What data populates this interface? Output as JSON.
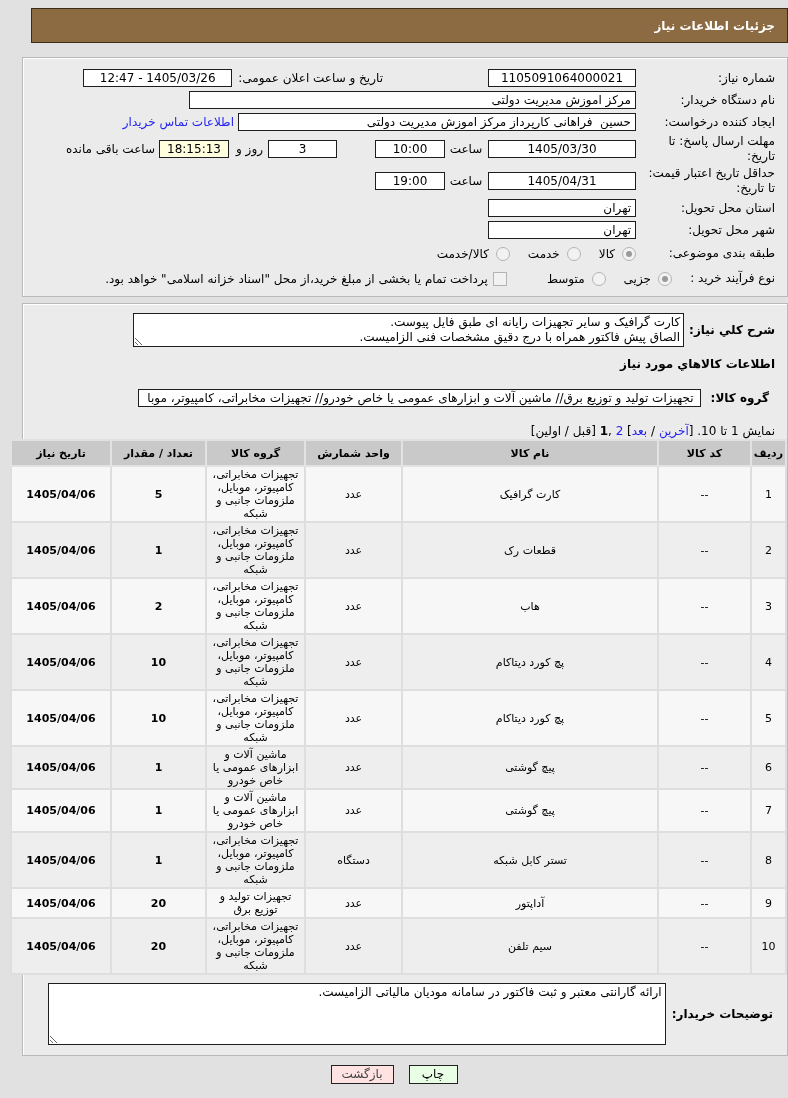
{
  "header": {
    "title": "جزئیات اطلاعات نیاز"
  },
  "details": {
    "need_number": {
      "label": "شماره نیاز:",
      "value": "1105091064000021"
    },
    "announce_datetime": {
      "label": "تاریخ و ساعت اعلان عمومی:",
      "value": "1405/03/26 - 12:47"
    },
    "buyer_org": {
      "label": "نام دستگاه خریدار:",
      "value": "مرکز اموزش مدیریت دولتی"
    },
    "requester": {
      "label": "ایجاد کننده درخواست:",
      "value": "حسین  فراهانی کارپرداز مرکز اموزش مدیریت دولتی",
      "contact_link": "اطلاعات تماس خریدار"
    },
    "reply_deadline": {
      "label": "مهلت ارسال پاسخ: تا تاریخ:",
      "date": "1405/03/30",
      "time_label": "ساعت",
      "time": "10:00",
      "days": "3",
      "days_label": "روز و",
      "remaining": "18:15:13",
      "remaining_label": "ساعت باقی مانده"
    },
    "price_validity": {
      "label": "حداقل تاریخ اعتبار قیمت: تا تاریخ:",
      "date": "1405/04/31",
      "time_label": "ساعت",
      "time": "19:00"
    },
    "province": {
      "label": "استان محل تحویل:",
      "value": "تهران"
    },
    "city": {
      "label": "شهر محل تحویل:",
      "value": "تهران"
    },
    "category": {
      "label": "طبقه بندی موضوعی:",
      "options": [
        {
          "label": "کالا",
          "selected": true
        },
        {
          "label": "خدمت",
          "selected": false
        },
        {
          "label": "کالا/خدمت",
          "selected": false
        }
      ]
    },
    "purchase_process": {
      "label": "نوع فرآیند خرید :",
      "options": [
        {
          "label": "جزیی",
          "selected": true
        },
        {
          "label": "متوسط",
          "selected": false
        }
      ],
      "treasury_payment": {
        "label": "پرداخت تمام یا بخشی از مبلغ خرید،از محل \"اسناد خزانه اسلامی\" خواهد بود.",
        "checked": false
      }
    }
  },
  "description": {
    "label": "شرح کلي نیاز:",
    "value": "کارت گرافیک و سایر تجهیزات رایانه ای طبق فایل پیوست.\nالصاق پیش فاکتور همراه با درج دقیق مشخصات فنی الزامیست."
  },
  "goods": {
    "title": "اطلاعات کالاهاي مورد نیاز",
    "group_label": "گروه کالا:",
    "group_value": "تجهیزات تولید و توزیع برق//  ماشین آلات و ابزارهای عمومی یا خاص خودرو// تجهیزات مخابراتی، کامپیوتر، موبا",
    "pagination": [
      {
        "kind": "text",
        "text": "نمایش 1 تا 10. ["
      },
      {
        "kind": "link",
        "text": "آخرین"
      },
      {
        "kind": "text",
        "text": " / "
      },
      {
        "kind": "link",
        "text": "بعد"
      },
      {
        "kind": "text",
        "text": "] "
      },
      {
        "kind": "link",
        "text": "2"
      },
      {
        "kind": "text",
        "text": " ,"
      },
      {
        "kind": "current",
        "text": "1"
      },
      {
        "kind": "text",
        "text": " [قبل / اولین]"
      }
    ],
    "table": {
      "columns": [
        "ردیف",
        "کد کالا",
        "نام کالا",
        "واحد شمارش",
        "گروه کالا",
        "تعداد / مقدار",
        "تاریخ نیاز"
      ],
      "rows": [
        [
          "1",
          "--",
          "کارت گرافیک",
          "عدد",
          "تجهیزات مخابراتی، کامپیوتر، موبایل، ملزومات جانبی و شبکه",
          "5",
          "1405/04/06"
        ],
        [
          "2",
          "--",
          "قطعات رک",
          "عدد",
          "تجهیزات مخابراتی، کامپیوتر، موبایل، ملزومات جانبی و شبکه",
          "1",
          "1405/04/06"
        ],
        [
          "3",
          "--",
          "هاب",
          "عدد",
          "تجهیزات مخابراتی، کامپیوتر، موبایل، ملزومات جانبی و شبکه",
          "2",
          "1405/04/06"
        ],
        [
          "4",
          "--",
          "پچ کورد دیتاکام",
          "عدد",
          "تجهیزات مخابراتی، کامپیوتر، موبایل، ملزومات جانبی و شبکه",
          "10",
          "1405/04/06"
        ],
        [
          "5",
          "--",
          "پچ کورد دیتاکام",
          "عدد",
          "تجهیزات مخابراتی، کامپیوتر، موبایل، ملزومات جانبی و شبکه",
          "10",
          "1405/04/06"
        ],
        [
          "6",
          "--",
          "پیچ گوشتی",
          "عدد",
          "ماشین آلات و ابزارهای عمومی یا خاص خودرو",
          "1",
          "1405/04/06"
        ],
        [
          "7",
          "--",
          "پیچ گوشتی",
          "عدد",
          "ماشین آلات و ابزارهای عمومی یا خاص خودرو",
          "1",
          "1405/04/06"
        ],
        [
          "8",
          "--",
          "تستر کابل شبکه",
          "دستگاه",
          "تجهیزات مخابراتی، کامپیوتر، موبایل، ملزومات جانبی و شبکه",
          "1",
          "1405/04/06"
        ],
        [
          "9",
          "--",
          "آداپتور",
          "عدد",
          "تجهیزات تولید و توزیع برق",
          "20",
          "1405/04/06"
        ],
        [
          "10",
          "--",
          "سیم تلفن",
          "عدد",
          "تجهیزات مخابراتی، کامپیوتر، موبایل، ملزومات جانبی و شبکه",
          "20",
          "1405/04/06"
        ]
      ]
    }
  },
  "buyer_notes": {
    "label": "توضیحات خریدار:",
    "value": "ارائه گارانتی معتبر و ثبت فاکتور در سامانه مودیان مالیاتی الزامیست."
  },
  "buttons": [
    {
      "kind": "print",
      "label": "چاپ"
    },
    {
      "kind": "back",
      "label": "بازگشت"
    }
  ]
}
